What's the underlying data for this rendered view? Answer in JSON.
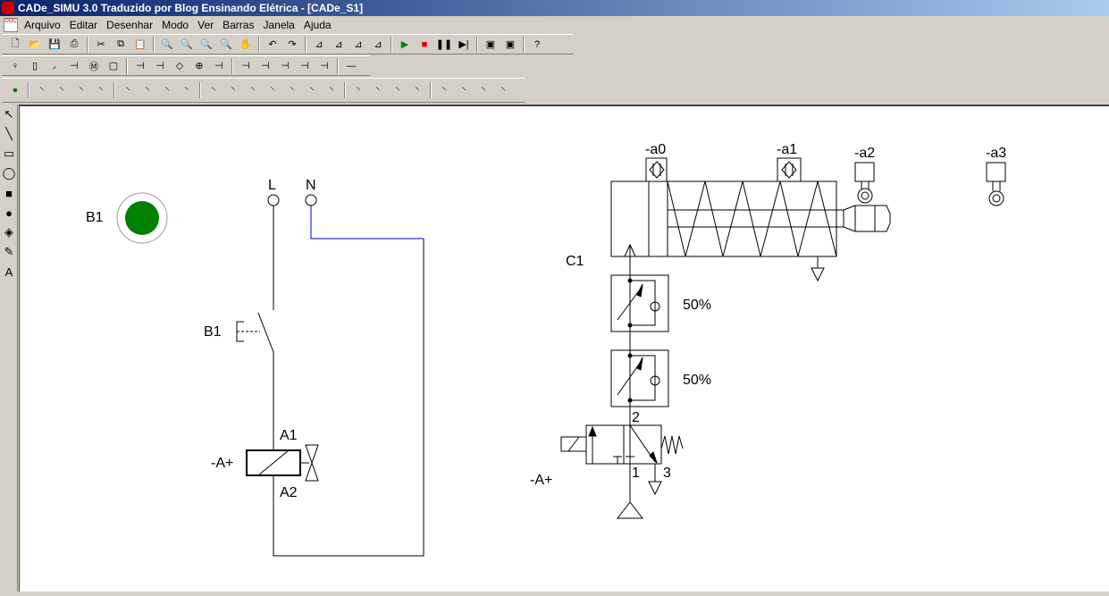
{
  "window": {
    "title": "CADe_SIMU 3.0 Traduzido por Blog Ensinando Elétrica - [CADe_S1]"
  },
  "menu": [
    "Arquivo",
    "Editar",
    "Desenhar",
    "Modo",
    "Ver",
    "Barras",
    "Janela",
    "Ajuda"
  ],
  "toolbar1": [
    "new",
    "open",
    "save",
    "print",
    "|",
    "cut",
    "copy",
    "paste",
    "|",
    "zoom-in",
    "zoom-out",
    "zoom-window",
    "zoom-fit",
    "pan",
    "|",
    "undo",
    "redo",
    "|",
    "align-1",
    "align-2",
    "align-3",
    "align-4",
    "|",
    "play",
    "stop",
    "pause",
    "step",
    "|",
    "window-1",
    "window-2",
    "|",
    "help"
  ],
  "toolbar2": [
    "lamp",
    "fuse",
    "switch",
    "triple-switch",
    "motor",
    "relay",
    "|",
    "contact-no",
    "push-no",
    "diamond",
    "coil",
    "coil-2",
    "|",
    "logic",
    "contactor",
    "timer",
    "io",
    "plc",
    "|",
    "wire"
  ],
  "toolbar3": [
    "green-lamp",
    "|",
    "e-no",
    "e-nc",
    "e-nonc",
    "e-nc2",
    "|",
    "o-no",
    "o-nc",
    "o-nonc",
    "o-nc2",
    "|",
    "f-no",
    "f-nc",
    "f-nonc",
    "f-nc2",
    "f-no3",
    "f-nc3",
    "f-x",
    "|",
    "c-no",
    "c-nc",
    "c-nonc",
    "c-nc2",
    "|",
    "d-no",
    "d-nc",
    "d-nonc",
    "d-nc2"
  ],
  "palette": [
    "select",
    "line",
    "rectangle",
    "ellipse",
    "filled-rectangle",
    "filled-ellipse",
    "fill",
    "color-picker",
    "text"
  ],
  "palette_glyphs": [
    "↖",
    "╲",
    "▭",
    "◯",
    "■",
    "●",
    "◈",
    "✎",
    "A"
  ],
  "diagram": {
    "lamp_label": "B1",
    "lamp_color": "#008000",
    "line_label": "L",
    "neutral_label": "N",
    "switch_label": "B1",
    "coil_label": "-A+",
    "coil_a1": "A1",
    "coil_a2": "A2",
    "sensors": [
      "-a0",
      "-a1",
      "-a2",
      "-a3"
    ],
    "cylinder_label": "C1",
    "flow1": "50%",
    "flow2": "50%",
    "valve_label": "-A+",
    "port2": "2",
    "port1": "1",
    "port3": "3",
    "neutral_wire_color": "#0000cc"
  }
}
